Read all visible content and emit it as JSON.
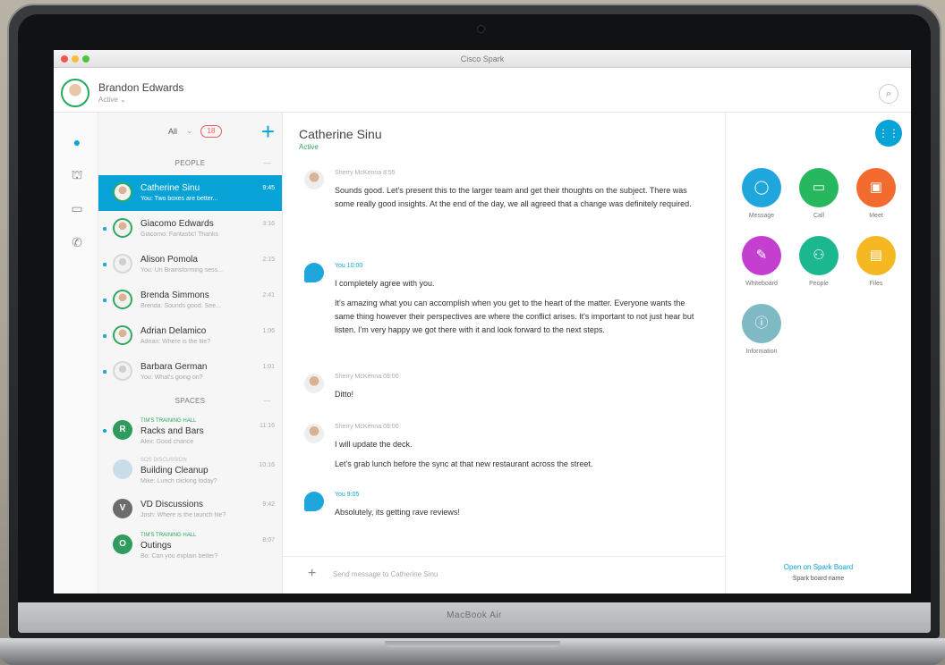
{
  "device": {
    "label": "MacBook Air"
  },
  "window": {
    "title": "Cisco Spark"
  },
  "user": {
    "name": "Brandon Edwards",
    "status": "Active ⌄"
  },
  "rail": {
    "icons": [
      "chat-bubble-icon",
      "team-icon",
      "calendar-icon",
      "phone-icon"
    ]
  },
  "list": {
    "filter": "All",
    "unread_count": "18",
    "people_header": "PEOPLE",
    "spaces_header": "SPACES",
    "people": [
      {
        "name": "Catherine Sinu",
        "sub": "You: Two boxes are better...",
        "time": "9:45"
      },
      {
        "name": "Giacomo Edwards",
        "sub": "Giacomo: Fantastic! Thanks",
        "time": "3:16"
      },
      {
        "name": "Alison Pomola",
        "sub": "You: Un Brainstorming sess...",
        "time": "2:15"
      },
      {
        "name": "Brenda Simmons",
        "sub": "Brenda: Sounds good. See...",
        "time": "2:41"
      },
      {
        "name": "Adrian Delamico",
        "sub": "Adrian: Where is the file?",
        "time": "1:06"
      },
      {
        "name": "Barbara German",
        "sub": "You: What's going on?",
        "time": "1:01"
      }
    ],
    "spaces": [
      {
        "tag": "TIM'S TRAINING HALL",
        "name": "Racks and Bars",
        "sub": "Alex: Good chance",
        "time": "11:16",
        "letter": "R"
      },
      {
        "tag": "SOS DISCUSSION",
        "name": "Building Cleanup",
        "sub": "Mike: Lunch clicking today?",
        "time": "10:16",
        "letter": ""
      },
      {
        "tag": "",
        "name": "VD Discussions",
        "sub": "Josh: Where is the launch file?",
        "time": "9:42",
        "letter": "V"
      },
      {
        "tag": "TIM'S TRAINING HALL",
        "name": "Outings",
        "sub": "Bo: Can you explain better?",
        "time": "8:07",
        "letter": "O"
      }
    ]
  },
  "chat": {
    "title": "Catherine Sinu",
    "status": "Active",
    "messages": [
      {
        "meta": "Sherry McKenna 8:55",
        "body": "Sounds good. Let's present this to the larger team and get their thoughts on the subject. There was some really good insights. At the end of the day, we all agreed that a change was definitely required."
      },
      {
        "meta": "You 10:00",
        "body": "I completely agree with you.",
        "body2": "It's amazing what you can accomplish when you get to the heart of the matter. Everyone wants the same thing however their perspectives are where the conflict arises. It's important to not just hear but listen. I'm very happy we got there with it and look forward to the next steps."
      },
      {
        "meta": "Sherry McKenna 09:00",
        "body": "Ditto!"
      },
      {
        "meta": "Sherry McKenna 09:00",
        "body": "I will update the deck.",
        "body2": "Let's grab lunch before the sync at that new restaurant across the street."
      },
      {
        "meta": "You 9:05",
        "body": "Absolutely, its getting rave reviews!"
      }
    ],
    "composer_placeholder": "Send message to Catherine Sinu"
  },
  "panel": {
    "actions": [
      {
        "label": "Message",
        "color": "#1fa6dd",
        "icon": "message-icon"
      },
      {
        "label": "Call",
        "color": "#27b75f",
        "icon": "video-call-icon"
      },
      {
        "label": "Meet",
        "color": "#f36b2e",
        "icon": "meet-icon"
      },
      {
        "label": "Whiteboard",
        "color": "#c43fd0",
        "icon": "pencil-icon"
      },
      {
        "label": "People",
        "color": "#1bb890",
        "icon": "people-icon"
      },
      {
        "label": "Files",
        "color": "#f5b822",
        "icon": "files-icon"
      },
      {
        "label": "Information",
        "color": "#7fb9c4",
        "icon": "info-icon"
      }
    ],
    "board_link": "Open on Spark Board",
    "board_name": "Spark board name"
  }
}
